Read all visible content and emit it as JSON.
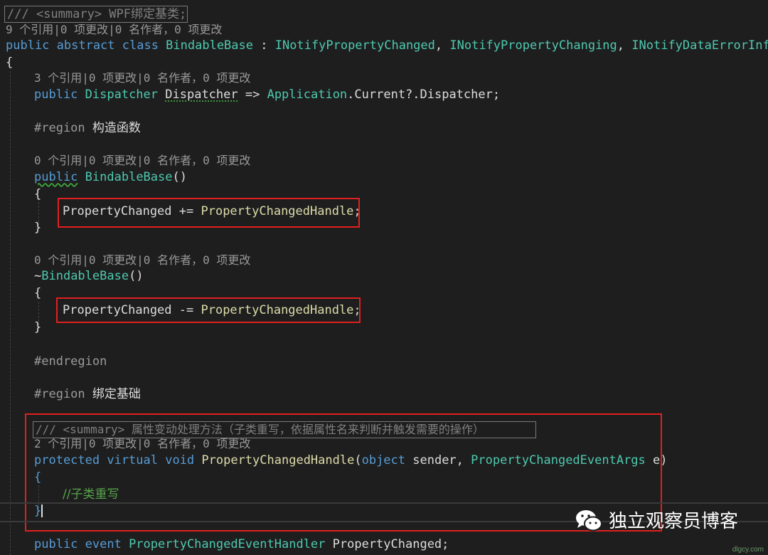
{
  "lines": {
    "l1_doc": "/// <summary> WPF绑定基类;",
    "l2_lens": "9 个引用|0 项更改|0 名作者，0 项更改",
    "l3": {
      "kw": "public abstract class ",
      "name": "BindableBase",
      "rest1": " : ",
      "i1": "INotifyPropertyChanged",
      "sep1": ", ",
      "i2": "INotifyPropertyChanging",
      "sep2": ", ",
      "i3": "INotifyDataErrorInfo"
    },
    "l4": "{",
    "l5_lens": "3 个引用|0 项更改|0 名作者，0 项更改",
    "l6": {
      "kw": "public ",
      "type": "Dispatcher",
      "sp": " ",
      "name": "Dispatcher",
      "arrow": " => ",
      "app": "Application",
      "rest": ".Current?.Dispatcher;"
    },
    "l7": {
      "dir": "#region ",
      "label": "构造函数"
    },
    "l8_lens": "0 个引用|0 项更改|0 名作者，0 项更改",
    "l9": {
      "kw": "public",
      "sp": " ",
      "name": "BindableBase",
      "rest": "()"
    },
    "l10": "{",
    "l11": {
      "a": "PropertyChanged",
      "op": " += ",
      "b": "PropertyChangedHandle",
      "end": ";"
    },
    "l12": "}",
    "l13_lens": "0 个引用|0 项更改|0 名作者，0 项更改",
    "l14": {
      "tilde": "~",
      "name": "BindableBase",
      "rest": "()"
    },
    "l15": "{",
    "l16": {
      "a": "PropertyChanged",
      "op": " -= ",
      "b": "PropertyChangedHandle",
      "end": ";"
    },
    "l17": "}",
    "l18": "#endregion",
    "l19": {
      "dir": "#region ",
      "label": "绑定基础"
    },
    "l20_doc": "/// <summary> 属性变动处理方法（子类重写，依据属性名来判断并触发需要的操作）",
    "l21_lens": "2 个引用|0 项更改|0 名作者，0 项更改",
    "l22": {
      "kw1": "protected virtual void ",
      "name": "PropertyChangedHandle",
      "p1": "(",
      "kw2": "object",
      "p2": " sender, ",
      "type": "PropertyChangedEventArgs",
      "p3": " e)"
    },
    "l23": "{",
    "l24_comment": "//子类重写",
    "l25": "}",
    "l26": {
      "kw": "public event ",
      "type": "PropertyChangedEventHandler",
      "rest": " PropertyChanged;"
    }
  },
  "watermark": {
    "text": "独立观察员博客",
    "icon": "wechat-icon"
  },
  "site_url": "dlgcy.com",
  "colors": {
    "keyword": "#569cd6",
    "type": "#4ec9b0",
    "method": "#dcdcaa",
    "comment": "#57a64a",
    "highlight": "#e02020"
  }
}
